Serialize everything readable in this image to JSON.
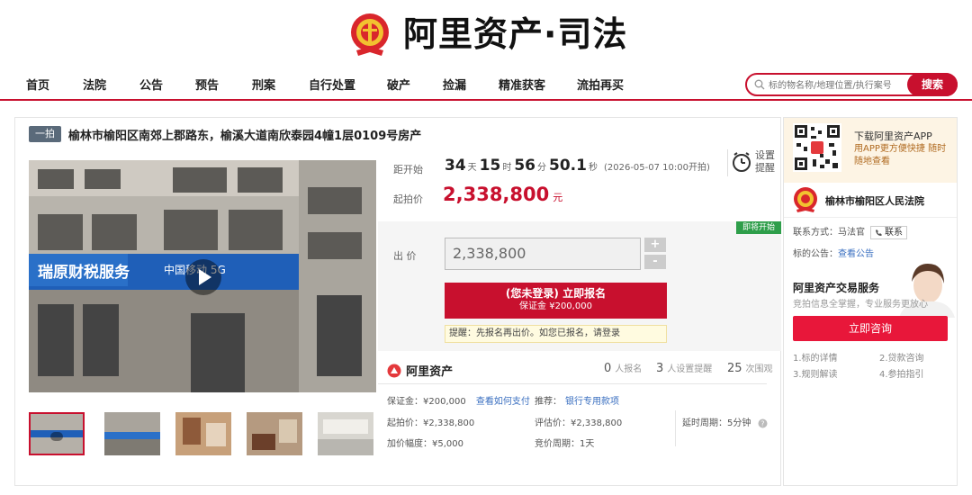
{
  "header": {
    "logo_text": "阿里资产·司法"
  },
  "nav": {
    "items": [
      "首页",
      "法院",
      "公告",
      "预告",
      "刑案",
      "自行处置",
      "破产",
      "捡漏",
      "精准获客",
      "流拍再买"
    ],
    "search_placeholder": "标的物名称/地理位置/执行案号",
    "search_button": "搜索"
  },
  "lot": {
    "badge": "一拍",
    "title": "榆林市榆阳区南郊上郡路东，榆溪大道南欣泰园4幢1层0109号房产",
    "photo_sign_text": "中国移动 5G",
    "thumb_count": 5
  },
  "auction": {
    "countdown_label": "距开始",
    "days": "34",
    "days_unit": "天",
    "hours": "15",
    "hours_unit": "时",
    "minutes": "56",
    "minutes_unit": "分",
    "seconds": "50.1",
    "seconds_unit": "秒",
    "start_time": "(2026-05-07 10:00开拍)",
    "reminder_label": "设置提醒",
    "start_price_label": "起拍价",
    "start_price": "2,338,800",
    "start_price_unit": "元",
    "soon_badge": "即将开始",
    "bid_label": "出 价",
    "bid_value": "2,338,800",
    "plus": "+",
    "minus": "-",
    "signup_line1": "(您未登录) 立即报名",
    "signup_line2": "保证金 ¥200,000",
    "tip": "提醒：先报名再出价。如您已报名，请登录"
  },
  "stats": {
    "brand": "阿里资产",
    "signups": "0",
    "signups_label": "人报名",
    "reminders": "3",
    "reminders_label": "人设置提醒",
    "views": "25",
    "views_label": "次围观"
  },
  "details": {
    "deposit": "保证金：¥200,000",
    "how_to_pay": "查看如何支付",
    "recommend_label": "推荐：",
    "recommend_link": "银行专用款项",
    "start_price": "起拍价：¥2,338,800",
    "appraisal": "评估价：¥2,338,800",
    "extension": "延时周期：5分钟",
    "increment": "加价幅度：¥5,000",
    "bid_period": "竞价周期：1天"
  },
  "sidebar": {
    "app_title": "下载阿里资产APP",
    "app_sub": "用APP更方便快捷 随时随地查看",
    "court_name": "榆林市榆阳区人民法院",
    "contact_label": "联系方式：马法官",
    "contact_button": "联系",
    "notice_label": "标的公告：",
    "notice_link": "查看公告",
    "service_title": "阿里资产交易服务",
    "service_sub": "竞拍信息全掌握，专业服务更放心",
    "consult_button": "立即咨询",
    "links": [
      "1.标的详情",
      "2.贷款咨询",
      "3.规则解读",
      "4.参拍指引"
    ]
  },
  "colors": {
    "brand_red": "#c8102e",
    "green_badge": "#2e9e4a",
    "link_blue": "#3a6fc0"
  }
}
